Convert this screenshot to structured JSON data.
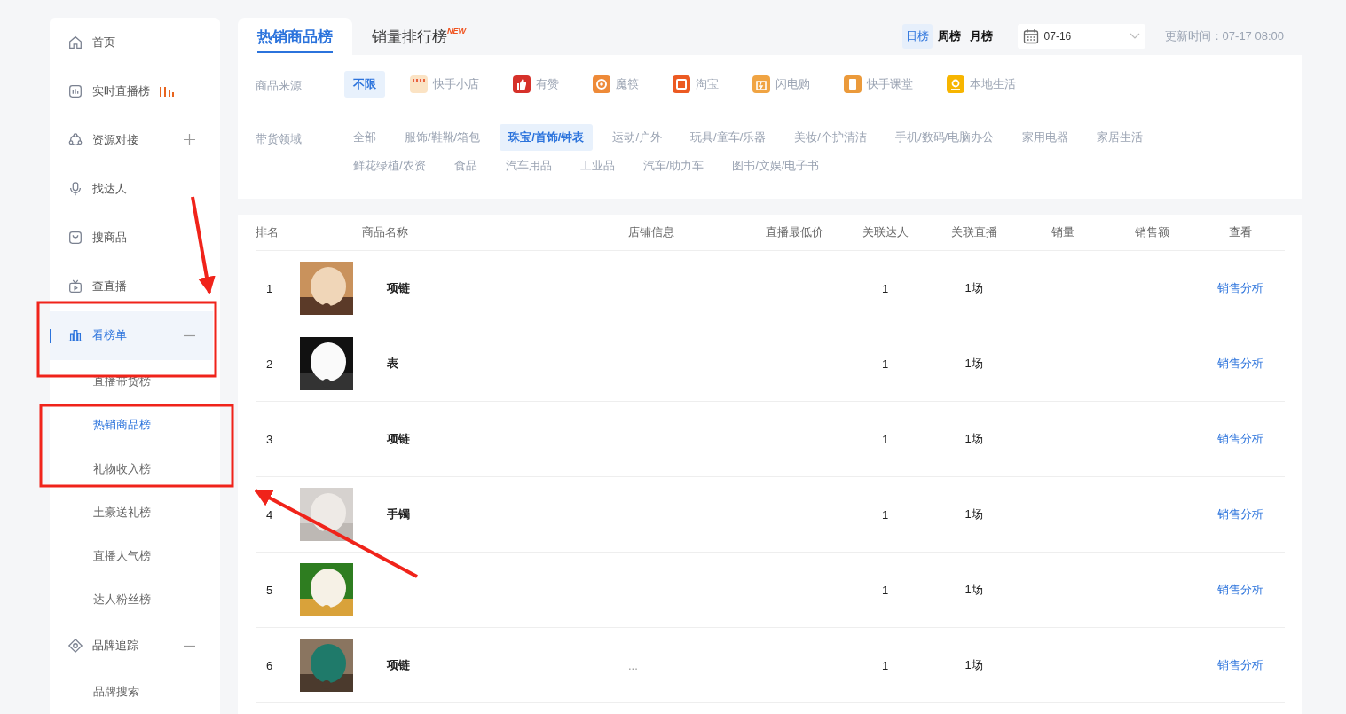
{
  "sidebar": {
    "items": [
      {
        "label": "首页",
        "selected": false,
        "live": false
      },
      {
        "label": "实时直播榜",
        "selected": false,
        "live": true
      },
      {
        "label": "资源对接",
        "selected": false,
        "live": false,
        "expanded": false
      },
      {
        "label": "找达人",
        "selected": false,
        "live": false
      },
      {
        "label": "搜商品",
        "selected": false,
        "live": false
      },
      {
        "label": "查直播",
        "selected": false,
        "live": false
      },
      {
        "label": "看榜单",
        "selected": true,
        "live": false,
        "expanded": true,
        "children": [
          {
            "label": "直播带货榜",
            "selected": false
          },
          {
            "label": "热销商品榜",
            "selected": true
          },
          {
            "label": "礼物收入榜",
            "selected": false
          },
          {
            "label": "土豪送礼榜",
            "selected": false
          },
          {
            "label": "直播人气榜",
            "selected": false
          },
          {
            "label": "达人粉丝榜",
            "selected": false
          }
        ]
      },
      {
        "label": "品牌追踪",
        "selected": false,
        "live": false,
        "expanded": true,
        "children": [
          {
            "label": "品牌搜索",
            "selected": false
          }
        ]
      }
    ]
  },
  "tabs": [
    {
      "label": "热销商品榜",
      "selected": true
    },
    {
      "label": "销量排行榜",
      "selected": false,
      "badge": "NEW"
    }
  ],
  "ranges": [
    {
      "label": "日榜",
      "selected": true
    },
    {
      "label": "周榜",
      "selected": false
    },
    {
      "label": "月榜",
      "selected": false
    }
  ],
  "date_picker": {
    "value": "07-16"
  },
  "update_time": "更新时间：07-17 08:00",
  "filters": [
    {
      "label": "商品来源",
      "kind": "source",
      "options": [
        {
          "label": "不限",
          "selected": true
        },
        {
          "label": "快手小店",
          "selected": false
        },
        {
          "label": "有赞",
          "selected": false
        },
        {
          "label": "魔筷",
          "selected": false
        },
        {
          "label": "淘宝",
          "selected": false
        },
        {
          "label": "闪电购",
          "selected": false
        },
        {
          "label": "快手课堂",
          "selected": false
        },
        {
          "label": "本地生活",
          "selected": false
        }
      ]
    },
    {
      "label": "带货领域",
      "kind": "category",
      "options": [
        {
          "label": "全部",
          "selected": false
        },
        {
          "label": "服饰/鞋靴/箱包",
          "selected": false
        },
        {
          "label": "珠宝/首饰/钟表",
          "selected": true
        },
        {
          "label": "运动/户外",
          "selected": false
        },
        {
          "label": "玩具/童车/乐器",
          "selected": false
        },
        {
          "label": "美妆/个护清洁",
          "selected": false
        },
        {
          "label": "手机/数码/电脑办公",
          "selected": false
        },
        {
          "label": "家用电器",
          "selected": false
        },
        {
          "label": "家居生活",
          "selected": false
        },
        {
          "label": "鲜花绿植/农资",
          "selected": false
        },
        {
          "label": "食品",
          "selected": false
        },
        {
          "label": "汽车用品",
          "selected": false
        },
        {
          "label": "工业品",
          "selected": false
        },
        {
          "label": "汽车/助力车",
          "selected": false
        },
        {
          "label": "图书/文娱/电子书",
          "selected": false
        }
      ]
    }
  ],
  "table": {
    "columns": [
      "排名",
      "商品名称",
      "店铺信息",
      "直播最低价",
      "关联达人",
      "关联直播",
      "销量",
      "销售额",
      "查看"
    ],
    "rows": [
      {
        "rank": "1",
        "thumbnail": true,
        "name": "项链",
        "talents": "1",
        "lives": "1场",
        "link": "销售分析"
      },
      {
        "rank": "2",
        "thumbnail": true,
        "name": "表",
        "talents": "1",
        "lives": "1场",
        "link": "销售分析"
      },
      {
        "rank": "3",
        "thumbnail": false,
        "name": "项链",
        "talents": "1",
        "lives": "1场",
        "link": "销售分析"
      },
      {
        "rank": "4",
        "thumbnail": true,
        "name": "手镯",
        "talents": "1",
        "lives": "1场",
        "link": "销售分析"
      },
      {
        "rank": "5",
        "thumbnail": true,
        "talents": "1",
        "lives": "1场",
        "link": "销售分析"
      },
      {
        "rank": "6",
        "thumbnail": true,
        "name": "项链",
        "shop": "...",
        "talents": "1",
        "lives": "1场",
        "link": "销售分析"
      }
    ]
  },
  "annotations": [
    {
      "kind": "arrow"
    },
    {
      "kind": "box"
    },
    {
      "kind": "box"
    },
    {
      "kind": "arrow"
    }
  ]
}
